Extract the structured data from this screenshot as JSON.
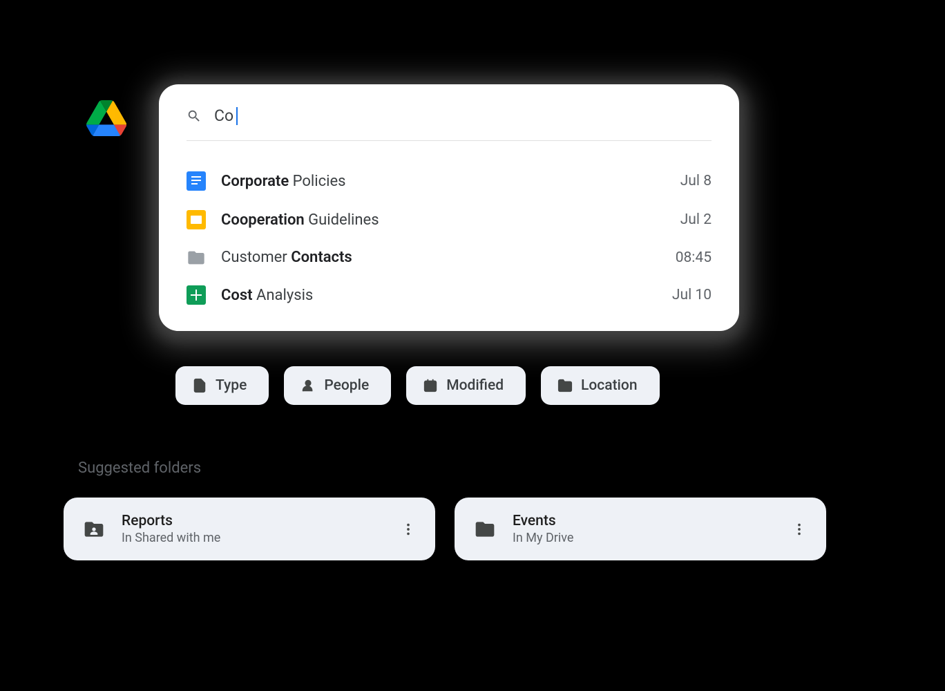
{
  "search": {
    "query": "Co"
  },
  "results": [
    {
      "bold": "Corporate",
      "rest": " Policies",
      "date": "Jul 8",
      "icon": "docs"
    },
    {
      "bold": "Cooperation",
      "rest": " Guidelines",
      "date": "Jul 2",
      "icon": "slides"
    },
    {
      "prefix": "Customer ",
      "bold": "Contacts",
      "date": "08:45",
      "icon": "folder"
    },
    {
      "bold": "Cost",
      "rest": " Analysis",
      "date": "Jul 10",
      "icon": "sheets"
    }
  ],
  "chips": [
    {
      "label": "Type",
      "icon": "file"
    },
    {
      "label": "People",
      "icon": "person"
    },
    {
      "label": "Modified",
      "icon": "calendar"
    },
    {
      "label": "Location",
      "icon": "folder-outline"
    }
  ],
  "suggested": {
    "heading": "Suggested folders",
    "folders": [
      {
        "name": "Reports",
        "location": "In Shared with me",
        "icon": "shared-folder"
      },
      {
        "name": "Events",
        "location": "In My Drive",
        "icon": "folder-solid"
      }
    ]
  }
}
